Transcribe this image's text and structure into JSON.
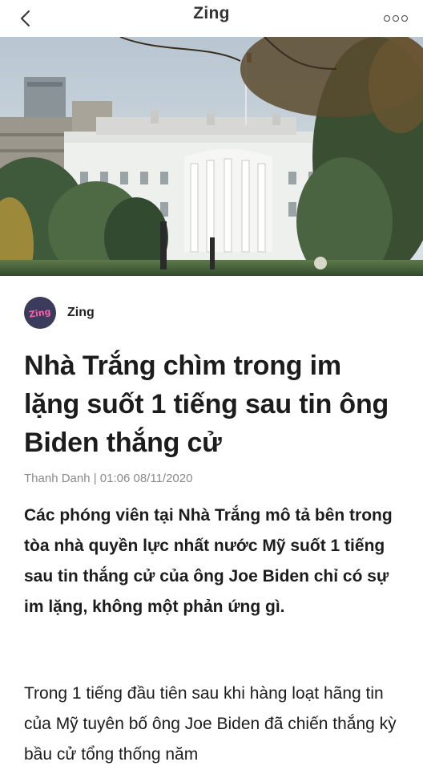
{
  "topbar": {
    "title": "Zing",
    "back_icon": "chevron-left-icon",
    "more_icon": "more-dots-icon"
  },
  "hero": {
    "image": "white-house-photo"
  },
  "source": {
    "logo_text": "Zing",
    "name": "Zing"
  },
  "article": {
    "headline": "Nhà Trắng chìm trong im lặng suốt 1 tiếng sau tin ông Biden thắng cử",
    "byline": "Thanh Danh | 01:06 08/11/2020",
    "sapo": "Các phóng viên tại Nhà Trắng mô tả bên trong tòa nhà quyền lực nhất nước Mỹ suốt 1 tiếng sau tin thắng cử của ông Joe Biden chỉ có sự im lặng, không một phản ứng gì.",
    "body": "Trong 1 tiếng đầu tiên sau khi hàng loạt hãng tin của Mỹ tuyên bố ông Joe Biden đã chiến thắng kỳ bầu cử tổng thống năm"
  },
  "colors": {
    "text": "#1c1c1c",
    "byline": "#8a8a8a",
    "logo_bg": "#3b3b5c",
    "logo_text": "#ff5fa8"
  }
}
